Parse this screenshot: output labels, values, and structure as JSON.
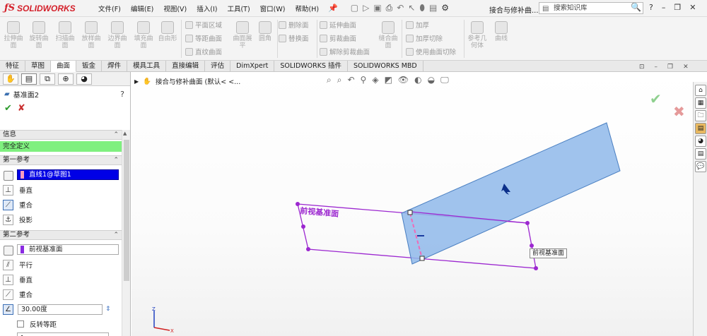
{
  "app": {
    "logo_ds": "ƒS",
    "logo_sw": "SOLIDWORKS",
    "doc_title": "接合与修补曲...",
    "search_placeholder": "搜索知识库"
  },
  "menu": [
    "文件(F)",
    "编辑(E)",
    "视图(V)",
    "插入(I)",
    "工具(T)",
    "窗口(W)",
    "帮助(H)"
  ],
  "ribbon": {
    "big": [
      {
        "label": "拉伸曲面"
      },
      {
        "label": "旋转曲面"
      },
      {
        "label": "扫描曲面"
      },
      {
        "label": "放样曲面"
      },
      {
        "label": "边界曲面"
      },
      {
        "label": "填充曲面"
      },
      {
        "label": "自由形"
      }
    ],
    "group2": [
      "平面区域",
      "等距曲面",
      "直纹曲面"
    ],
    "expand": "曲面展平",
    "fillet": "圆角",
    "group3": [
      "删除面",
      "替换面"
    ],
    "group4": [
      "延伸曲面",
      "剪裁曲面",
      "解除剪裁曲面"
    ],
    "knit": "缝合曲面",
    "group5": [
      "加厚",
      "加厚切除",
      "使用曲面切除"
    ],
    "refgeom": "参考几何体",
    "curves": "曲线"
  },
  "tabs": [
    "特征",
    "草图",
    "曲面",
    "钣金",
    "焊件",
    "模具工具",
    "直接编辑",
    "评估",
    "DimXpert",
    "SOLIDWORKS 插件",
    "SOLIDWORKS MBD"
  ],
  "active_tab": "曲面",
  "propmgr": {
    "title": "基准面2",
    "help": "?",
    "info_header": "信息",
    "status": "完全定义",
    "first_ref": {
      "header": "第一参考",
      "selection": "直线1@草图1",
      "selection_color": "#f79ac0",
      "options": [
        "垂直",
        "重合",
        "投影"
      ]
    },
    "second_ref": {
      "header": "第二参考",
      "selection": "前视基准面",
      "selection_color": "#8a2be2",
      "options": [
        "平行",
        "垂直",
        "重合"
      ],
      "angle": "30.00度",
      "flip": "反转等距",
      "count": "1"
    }
  },
  "graphics": {
    "tree_item": "接合与修补曲面 (默认< <...",
    "plane_label": "前视基准面",
    "plane_callout": "前视基准面",
    "triad_axes": [
      "Z",
      "X"
    ]
  },
  "colors": {
    "accent_plane": "#8fb9ea",
    "sketch": "#9c27d0",
    "ok": "#2b9a2b",
    "cancel": "#c92f2f",
    "fully_defined": "#7ff07f"
  }
}
